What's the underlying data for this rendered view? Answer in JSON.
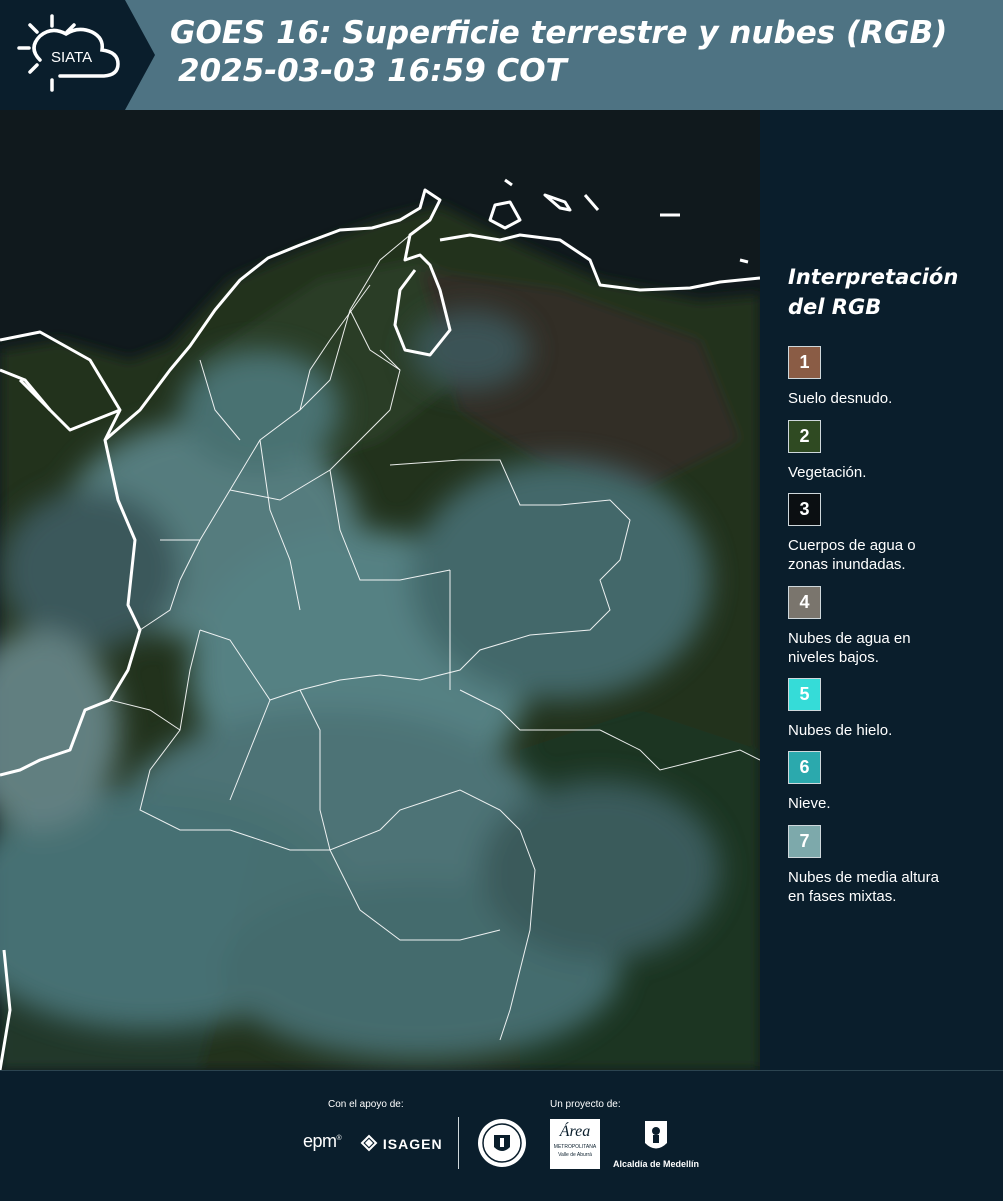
{
  "header": {
    "logo_text": "SIATA",
    "title_line1": "GOES 16: Superficie terrestre y nubes (RGB)",
    "title_line2": "2025-03-03 16:59 COT"
  },
  "legend": {
    "title_line1": "Interpretación",
    "title_line2": "del RGB",
    "items": [
      {
        "number": "1",
        "label": "Suelo desnudo.",
        "color": "#8a5c45"
      },
      {
        "number": "2",
        "label": "Vegetación.",
        "color": "#2f4a22"
      },
      {
        "number": "3",
        "label": "Cuerpos de agua o\nzonas inundadas.",
        "color": "#0b0f12"
      },
      {
        "number": "4",
        "label": "Nubes de agua en\nniveles bajos.",
        "color": "#7a756d"
      },
      {
        "number": "5",
        "label": "Nubes de hielo.",
        "color": "#35dcd8"
      },
      {
        "number": "6",
        "label": "Nieve.",
        "color": "#2ba9ad"
      },
      {
        "number": "7",
        "label": "Nubes de media altura\nen fases mixtas.",
        "color": "#7da9ab"
      }
    ]
  },
  "footer": {
    "support_caption": "Con el apoyo de:",
    "project_caption": "Un proyecto de:",
    "sponsor_epm": "epm",
    "sponsor_isagen": "ISAGEN",
    "partner_area_line1": "Área",
    "partner_area_line2": "METROPOLITANA",
    "partner_area_line3": "Valle de Aburrá",
    "partner_alcaldia": "Alcaldía de Medellín"
  },
  "colors": {
    "header_bg": "#4e7383",
    "panel_bg": "#0a1e2c",
    "border_line": "#ffffff"
  }
}
